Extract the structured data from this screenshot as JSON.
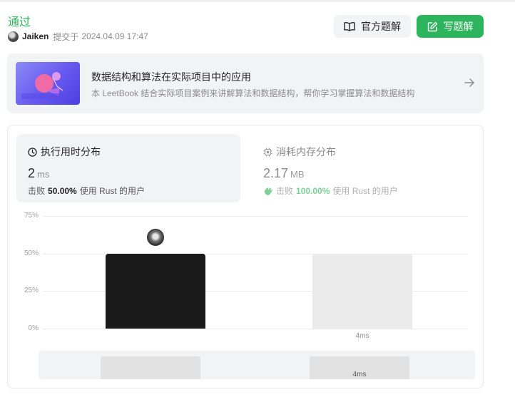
{
  "result": {
    "status": "通过",
    "author": "Jaiken",
    "submitted_label": "提交于",
    "submitted_time": "2024.04.09 17:47"
  },
  "actions": {
    "official_solution": "官方题解",
    "write_solution": "写题解"
  },
  "book": {
    "title": "数据结构和算法在实际项目中的应用",
    "subtitle": "本 LeetBook 结合实际项目案例来讲解算法和数据结构，帮你学习掌握算法和数据结构"
  },
  "runtime": {
    "label": "执行用时分布",
    "value": "2",
    "unit": "ms",
    "beats_prefix": "击败",
    "beats_pct": "50.00%",
    "beats_suffix": "使用 Rust 的用户"
  },
  "memory": {
    "label": "消耗内存分布",
    "value": "2.17",
    "unit": "MB",
    "beats_prefix": "击败",
    "beats_pct": "100.00%",
    "beats_suffix": "使用 Rust 的用户"
  },
  "colors": {
    "accent_green": "#2db55d",
    "bar_selected": "#1a1a1a",
    "bar_other": "#ebebeb"
  },
  "chart_data": {
    "type": "bar",
    "ylim": [
      0,
      75
    ],
    "yticks": [
      "75%",
      "50%",
      "25%",
      "0%"
    ],
    "ytick_values": [
      75,
      50,
      25,
      0
    ],
    "categories": [
      "",
      "4ms"
    ],
    "values": [
      50,
      50
    ],
    "selected_index": 0,
    "overview_label": "4ms"
  }
}
